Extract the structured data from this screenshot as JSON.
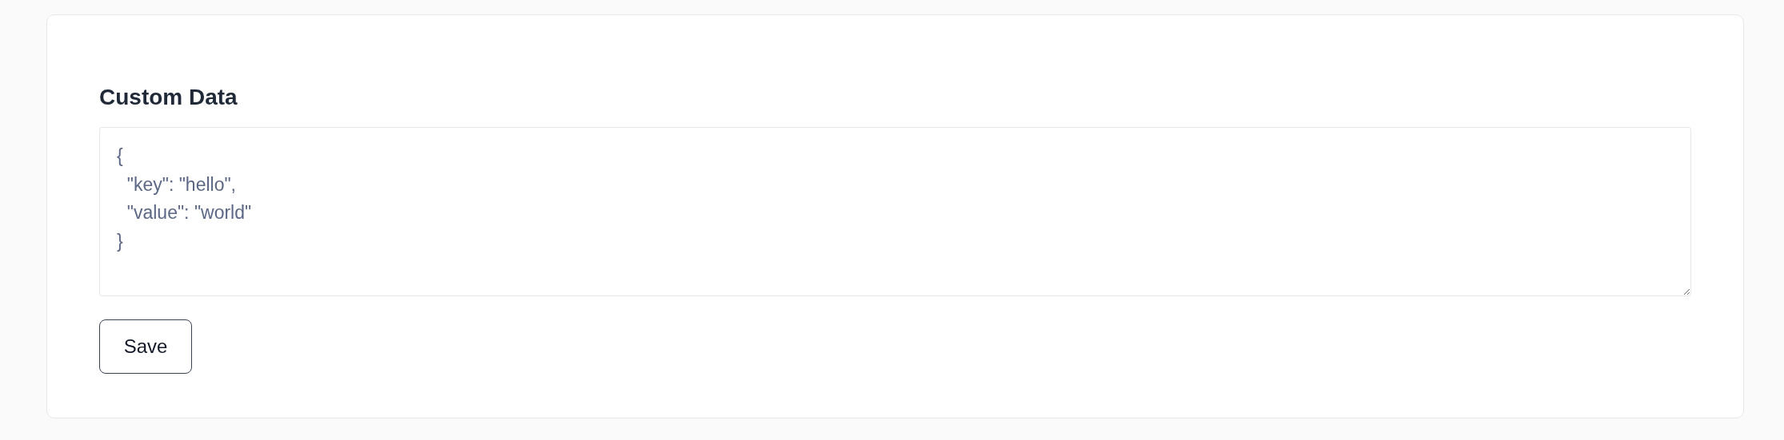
{
  "section": {
    "title": "Custom Data"
  },
  "editor": {
    "value": "{\n  \"key\": \"hello\",\n  \"value\": \"world\"\n}"
  },
  "buttons": [
    {
      "label": "Save"
    }
  ]
}
